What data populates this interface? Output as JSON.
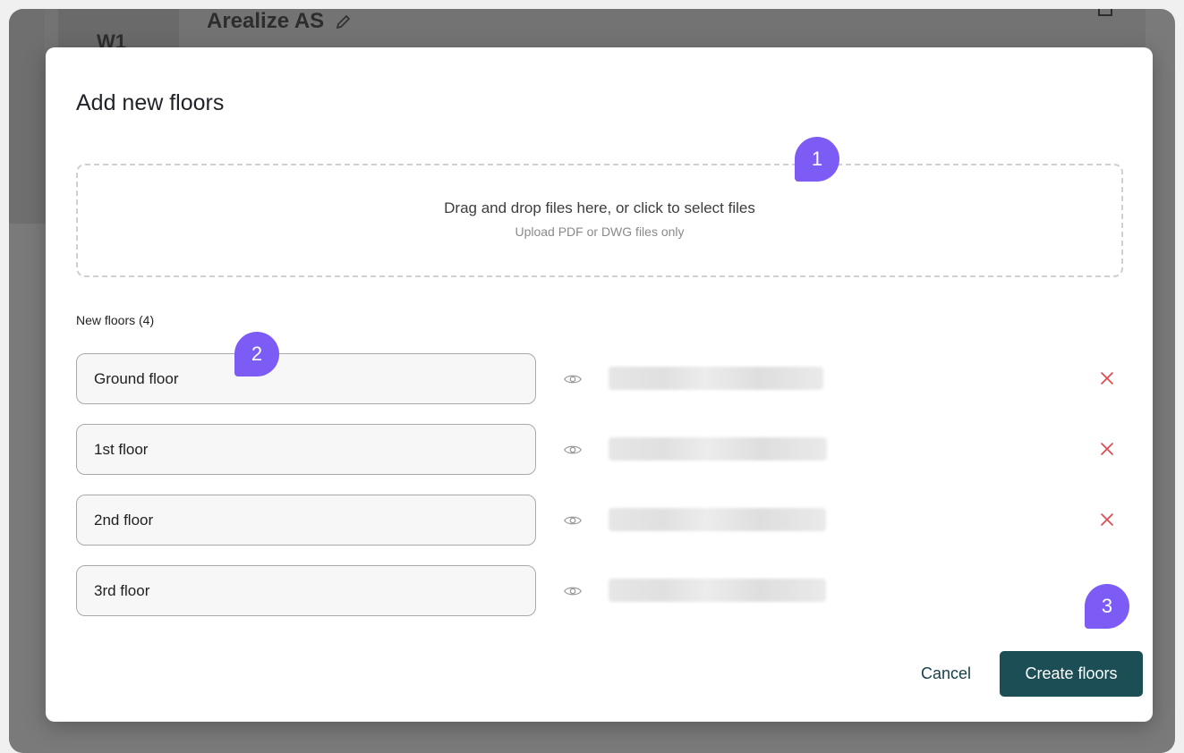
{
  "background": {
    "avatar_label": "W1",
    "project_title": "Arealize AS"
  },
  "modal": {
    "title": "Add new floors",
    "dropzone": {
      "main_text": "Drag and drop files here, or click to select files",
      "sub_text": "Upload PDF or DWG files only"
    },
    "section_label": "New floors (4)",
    "floors": [
      {
        "name": "Ground floor",
        "removable": true
      },
      {
        "name": "1st floor",
        "removable": true
      },
      {
        "name": "2nd floor",
        "removable": true
      },
      {
        "name": "3rd floor",
        "removable": false
      }
    ],
    "cancel_label": "Cancel",
    "create_label": "Create floors"
  },
  "callouts": [
    "1",
    "2",
    "3"
  ],
  "colors": {
    "accent": "#7c5cf5",
    "primary_button": "#1b4e55",
    "remove": "#e0454a"
  }
}
